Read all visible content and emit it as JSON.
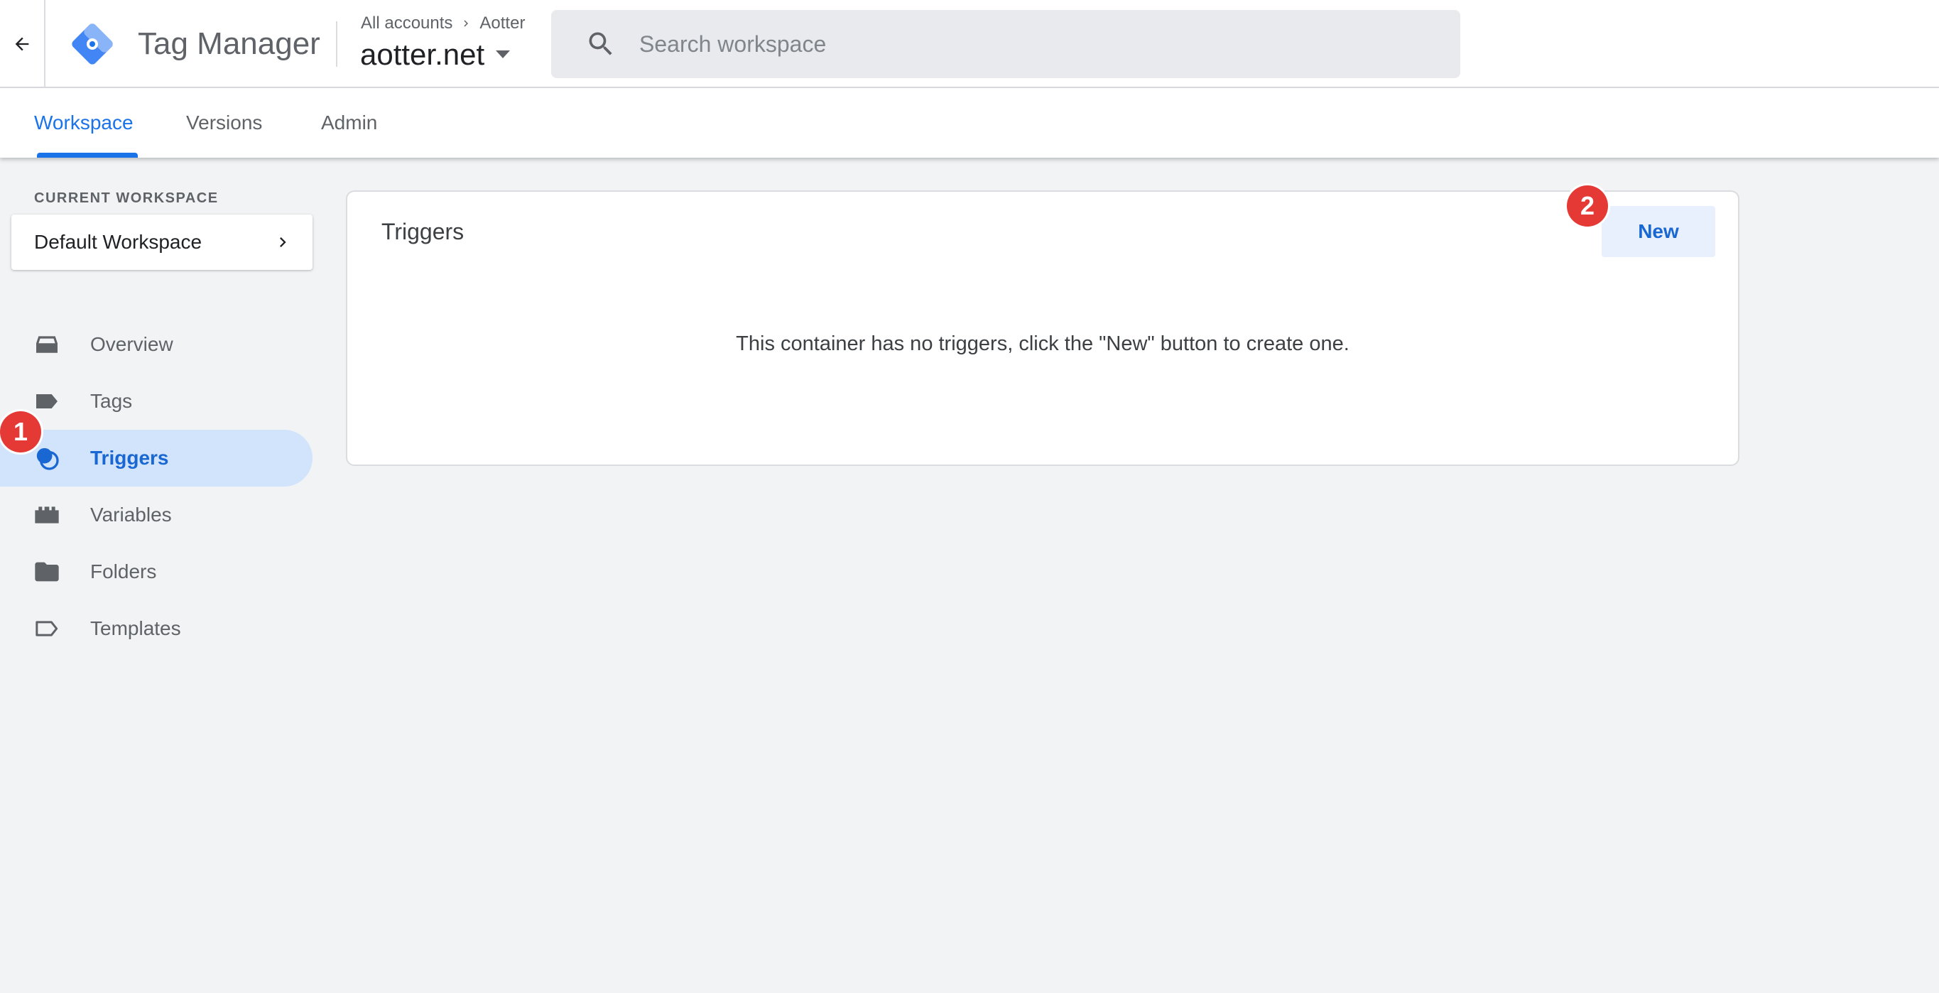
{
  "header": {
    "back_icon": "arrow-back-icon",
    "logo_icon": "tag-manager-logo",
    "product_name": "Tag Manager",
    "breadcrumb": {
      "accounts_label": "All accounts",
      "separator_icon": "chevron-right-icon",
      "account_name": "Aotter"
    },
    "container_name": "aotter.net",
    "container_dropdown_icon": "caret-down-icon",
    "search": {
      "icon": "search-icon",
      "placeholder": "Search workspace",
      "value": ""
    }
  },
  "tabs": [
    {
      "label": "Workspace",
      "active": true
    },
    {
      "label": "Versions",
      "active": false
    },
    {
      "label": "Admin",
      "active": false
    }
  ],
  "sidebar": {
    "current_workspace_label": "CURRENT WORKSPACE",
    "workspace_name": "Default Workspace",
    "workspace_chevron_icon": "chevron-right-icon",
    "items": [
      {
        "label": "Overview",
        "icon": "overview-icon",
        "active": false
      },
      {
        "label": "Tags",
        "icon": "tag-icon",
        "active": false
      },
      {
        "label": "Triggers",
        "icon": "trigger-icon",
        "active": true
      },
      {
        "label": "Variables",
        "icon": "variables-icon",
        "active": false
      },
      {
        "label": "Folders",
        "icon": "folder-icon",
        "active": false
      },
      {
        "label": "Templates",
        "icon": "template-icon",
        "active": false
      }
    ]
  },
  "main": {
    "card_title": "Triggers",
    "new_button_label": "New",
    "empty_message": "This container has no triggers, click the \"New\" button to create one."
  },
  "annotations": [
    {
      "number": "1",
      "color": "#e53935"
    },
    {
      "number": "2",
      "color": "#e53935"
    }
  ],
  "colors": {
    "accent": "#1a73e8",
    "active_nav_bg": "#d2e3fc",
    "new_button_bg": "#e8f0fe",
    "page_bg": "#f1f3f4",
    "badge": "#e53935"
  }
}
